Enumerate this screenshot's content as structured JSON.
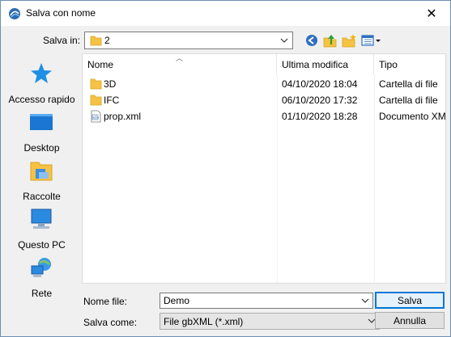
{
  "window": {
    "title": "Salva con nome",
    "close_glyph": "✕"
  },
  "toolbar": {
    "lookin_label": "Salva in:",
    "lookin_value": "2",
    "icons": [
      "back-icon",
      "up-folder-icon",
      "new-folder-icon",
      "view-menu-icon"
    ]
  },
  "places": [
    {
      "label": "Accesso rapido",
      "icon": "star-icon"
    },
    {
      "label": "Desktop",
      "icon": "desktop-icon"
    },
    {
      "label": "Raccolte",
      "icon": "libraries-icon"
    },
    {
      "label": "Questo PC",
      "icon": "computer-icon"
    },
    {
      "label": "Rete",
      "icon": "network-icon"
    }
  ],
  "filelist": {
    "columns": [
      "Nome",
      "Ultima modifica",
      "Tipo"
    ],
    "rows": [
      {
        "name": "3D",
        "date": "04/10/2020 18:04",
        "type": "Cartella di file",
        "icon": "folder-icon"
      },
      {
        "name": "IFC",
        "date": "06/10/2020 17:32",
        "type": "Cartella di file",
        "icon": "folder-icon"
      },
      {
        "name": "prop.xml",
        "date": "01/10/2020 18:28",
        "type": "Documento XM",
        "icon": "xml-file-icon"
      }
    ]
  },
  "footer": {
    "filename_label": "Nome file:",
    "filename_value": "Demo",
    "filetype_label": "Salva come:",
    "filetype_value": "File gbXML (*.xml)",
    "save_label": "Salva",
    "cancel_label": "Annulla"
  },
  "colors": {
    "accent": "#0078d7",
    "folder": "#f5c243"
  }
}
